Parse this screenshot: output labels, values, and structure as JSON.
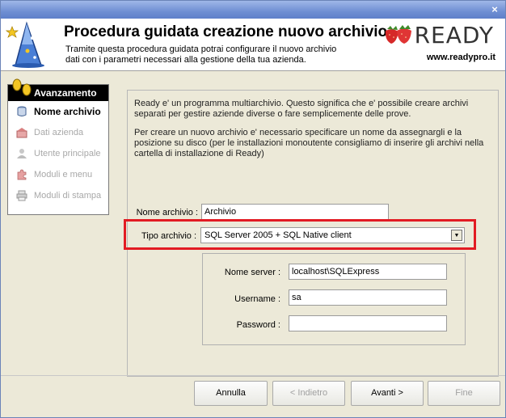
{
  "window": {
    "close_glyph": "×"
  },
  "header": {
    "title": "Procedura guidata creazione nuovo archivio",
    "description": "Tramite questa procedura guidata potrai configurare il nuovo archivio dati con i parametri necessari alla gestione della tua azienda.",
    "logo_text": "READY",
    "logo_url": "www.readypro.it"
  },
  "sidebar": {
    "title": "Avanzamento",
    "items": [
      {
        "label": "Nome archivio",
        "icon": "database-icon",
        "active": true
      },
      {
        "label": "Dati azienda",
        "icon": "company-icon",
        "active": false
      },
      {
        "label": "Utente principale",
        "icon": "user-icon",
        "active": false
      },
      {
        "label": "Moduli e menu",
        "icon": "puzzle-icon",
        "active": false
      },
      {
        "label": "Moduli di stampa",
        "icon": "printer-icon",
        "active": false
      }
    ]
  },
  "intro": {
    "p1": "Ready e' un programma multiarchivio. Questo significa che e' possibile creare archivi separati per gestire aziende diverse o fare semplicemente delle prove.",
    "p2": "Per creare un nuovo archivio e' necessario specificare un nome da assegnargli e la posizione su disco (per le installazioni monoutente consigliamo di inserire gli archivi nella cartella di installazione di Ready)"
  },
  "form": {
    "nome_archivio_label": "Nome archivio :",
    "nome_archivio_value": "Archivio",
    "tipo_archivio_label": "Tipo archivio :",
    "tipo_archivio_value": "SQL Server 2005 + SQL Native client",
    "nome_server_label": "Nome server :",
    "nome_server_value": "localhost\\SQLExpress",
    "username_label": "Username :",
    "username_value": "sa",
    "password_label": "Password :",
    "password_value": ""
  },
  "buttons": {
    "annulla": "Annulla",
    "indietro": "< Indietro",
    "avanti": "Avanti >",
    "fine": "Fine"
  },
  "colors": {
    "highlight": "#e21b23",
    "title_bar": "#6f8fd3"
  }
}
